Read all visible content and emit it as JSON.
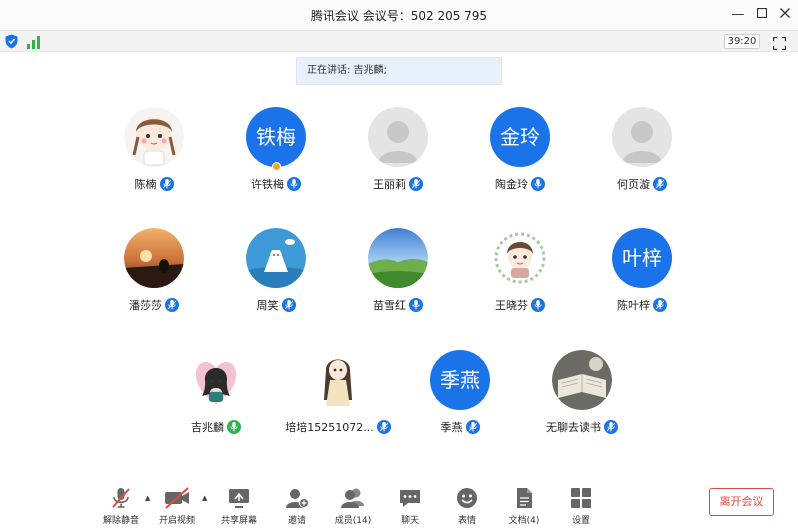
{
  "window": {
    "title": "腾讯会议 会议号：502 205 795"
  },
  "status": {
    "timer": "39:20"
  },
  "speaking": {
    "label": "正在讲话: 吉兆麟;"
  },
  "participants": [
    {
      "name": "陈楠",
      "avatar_type": "cartoon-girl"
    },
    {
      "name": "许铁梅",
      "avatar_text": "铁梅",
      "host": true
    },
    {
      "name": "王丽莉",
      "avatar_type": "default-gray"
    },
    {
      "name": "陶金玲",
      "avatar_text": "金玲"
    },
    {
      "name": "何页漩",
      "avatar_type": "default-gray"
    },
    {
      "name": "潘莎莎",
      "avatar_type": "sunset-photo"
    },
    {
      "name": "周笑",
      "avatar_type": "cartoon-bear"
    },
    {
      "name": "苗雪红",
      "avatar_type": "landscape-photo"
    },
    {
      "name": "王晓芬",
      "avatar_type": "cartoon-girl-wreath"
    },
    {
      "name": "陈叶梓",
      "avatar_text": "叶梓"
    },
    {
      "name": "吉兆麟",
      "avatar_type": "cartoon-girl-heart",
      "speaking": true
    },
    {
      "name": "培培15251072...",
      "avatar_type": "cartoon-girl-doll"
    },
    {
      "name": "季燕",
      "avatar_text": "季燕"
    },
    {
      "name": "无聊去读书",
      "avatar_type": "book-photo"
    }
  ],
  "toolbar": {
    "unmute": "解除静音",
    "start_video": "开启视频",
    "share_screen": "共享屏幕",
    "invite": "邀请",
    "members": "成员(14)",
    "chat": "聊天",
    "emoji": "表情",
    "docs": "文档(4)",
    "settings": "设置",
    "leave": "离开会议"
  },
  "colors": {
    "accent": "#1a73e8",
    "leave": "#e04b3f",
    "host": "#f5a623"
  }
}
